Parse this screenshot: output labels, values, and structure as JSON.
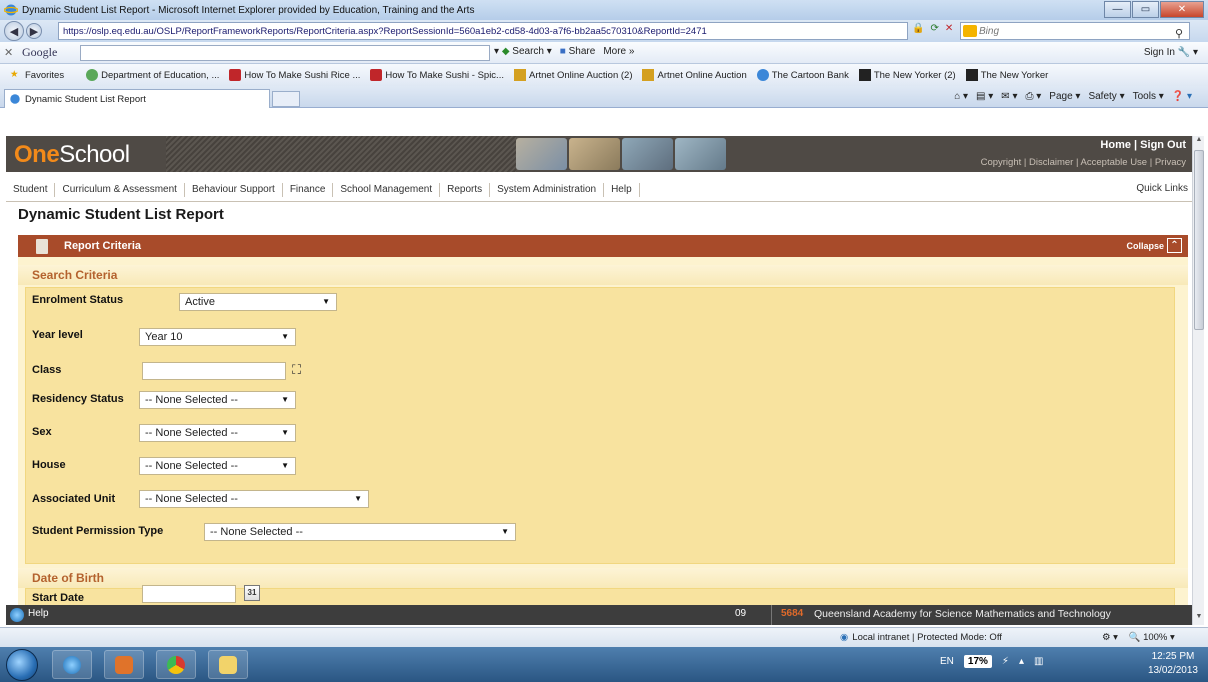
{
  "window": {
    "title": "Dynamic Student List Report - Microsoft Internet Explorer provided by Education, Training and the Arts"
  },
  "browser": {
    "address_url": "https://oslp.eq.edu.au/OSLP/ReportFrameworkReports/ReportCriteria.aspx?ReportSessionId=560a1eb2-cd58-4d03-a7f6-bb2aa5c70310&ReportId=2471",
    "search_engine": "Bing",
    "google": {
      "logo": "Google",
      "search_label": "Search",
      "share_label": "Share",
      "more_label": "More »",
      "signin_label": "Sign In"
    },
    "favorites_label": "Favorites",
    "favorites": [
      "Department of Education, ...",
      "How To Make Sushi Rice ...",
      "How To Make Sushi - Spic...",
      "Artnet Online Auction (2)",
      "Artnet Online Auction",
      "The Cartoon Bank",
      "The New Yorker (2)",
      "The New Yorker"
    ],
    "tab_title": "Dynamic Student List Report",
    "commands": [
      "Page ▾",
      "Safety ▾",
      "Tools ▾"
    ],
    "status_zone": "Local intranet | Protected Mode: Off",
    "zoom": "100%"
  },
  "app": {
    "logo_one": "One",
    "logo_school": "School",
    "top_links": "Home | Sign Out",
    "legal_links": "Copyright | Disclaimer | Acceptable Use | Privacy",
    "nav": [
      "Student",
      "Curriculum & Assessment",
      "Behaviour Support",
      "Finance",
      "School Management",
      "Reports",
      "System Administration",
      "Help"
    ],
    "quick_links": "Quick Links",
    "page_title": "Dynamic Student List Report",
    "panel_title": "Report Criteria",
    "collapse_label": "Collapse",
    "search_criteria_title": "Search Criteria",
    "fields": {
      "enrolment_status": {
        "label": "Enrolment Status",
        "value": "Active"
      },
      "year_level": {
        "label": "Year level",
        "value": "Year 10"
      },
      "class": {
        "label": "Class",
        "value": ""
      },
      "residency_status": {
        "label": "Residency Status",
        "value": "-- None Selected --"
      },
      "sex": {
        "label": "Sex",
        "value": "-- None Selected --"
      },
      "house": {
        "label": "House",
        "value": "-- None Selected --"
      },
      "associated_unit": {
        "label": "Associated Unit",
        "value": "-- None Selected --"
      },
      "student_permission_type": {
        "label": "Student Permission Type",
        "value": "-- None Selected --"
      }
    },
    "dob_title": "Date of Birth",
    "start_date_label": "Start Date",
    "calendar_day": "31",
    "footer": {
      "help": "Help",
      "code1": "09",
      "code2": "5684",
      "school": "Queensland Academy for Science Mathematics and Technology"
    }
  },
  "taskbar": {
    "language": "EN",
    "battery": "17%",
    "time": "12:25 PM",
    "date": "13/02/2013"
  }
}
